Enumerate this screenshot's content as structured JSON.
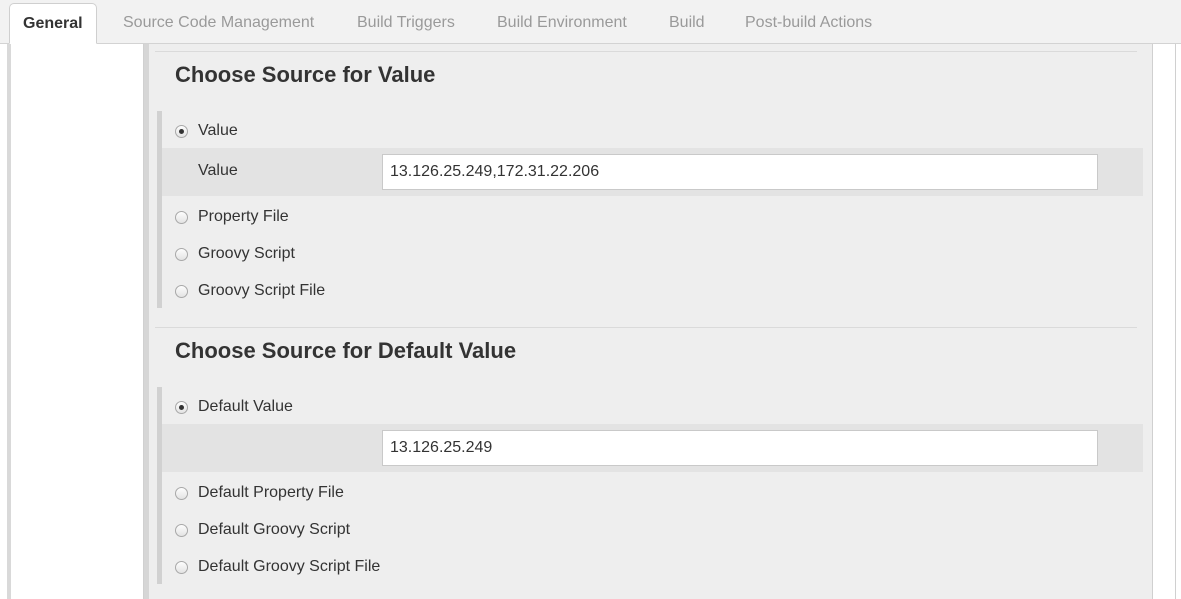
{
  "tabs": [
    {
      "label": "General"
    },
    {
      "label": "Source Code Management"
    },
    {
      "label": "Build Triggers"
    },
    {
      "label": "Build Environment"
    },
    {
      "label": "Build"
    },
    {
      "label": "Post-build Actions"
    }
  ],
  "value_section": {
    "title": "Choose Source for Value",
    "options": [
      {
        "label": "Value",
        "checked": true
      },
      {
        "label": "Property File",
        "checked": false
      },
      {
        "label": "Groovy Script",
        "checked": false
      },
      {
        "label": "Groovy Script File",
        "checked": false
      }
    ],
    "field_label": "Value",
    "field_value": "13.126.25.249,172.31.22.206"
  },
  "default_section": {
    "title": "Choose Source for Default Value",
    "options": [
      {
        "label": "Default Value",
        "checked": true
      },
      {
        "label": "Default Property File",
        "checked": false
      },
      {
        "label": "Default Groovy Script",
        "checked": false
      },
      {
        "label": "Default Groovy Script File",
        "checked": false
      }
    ],
    "field_value": "13.126.25.249"
  }
}
